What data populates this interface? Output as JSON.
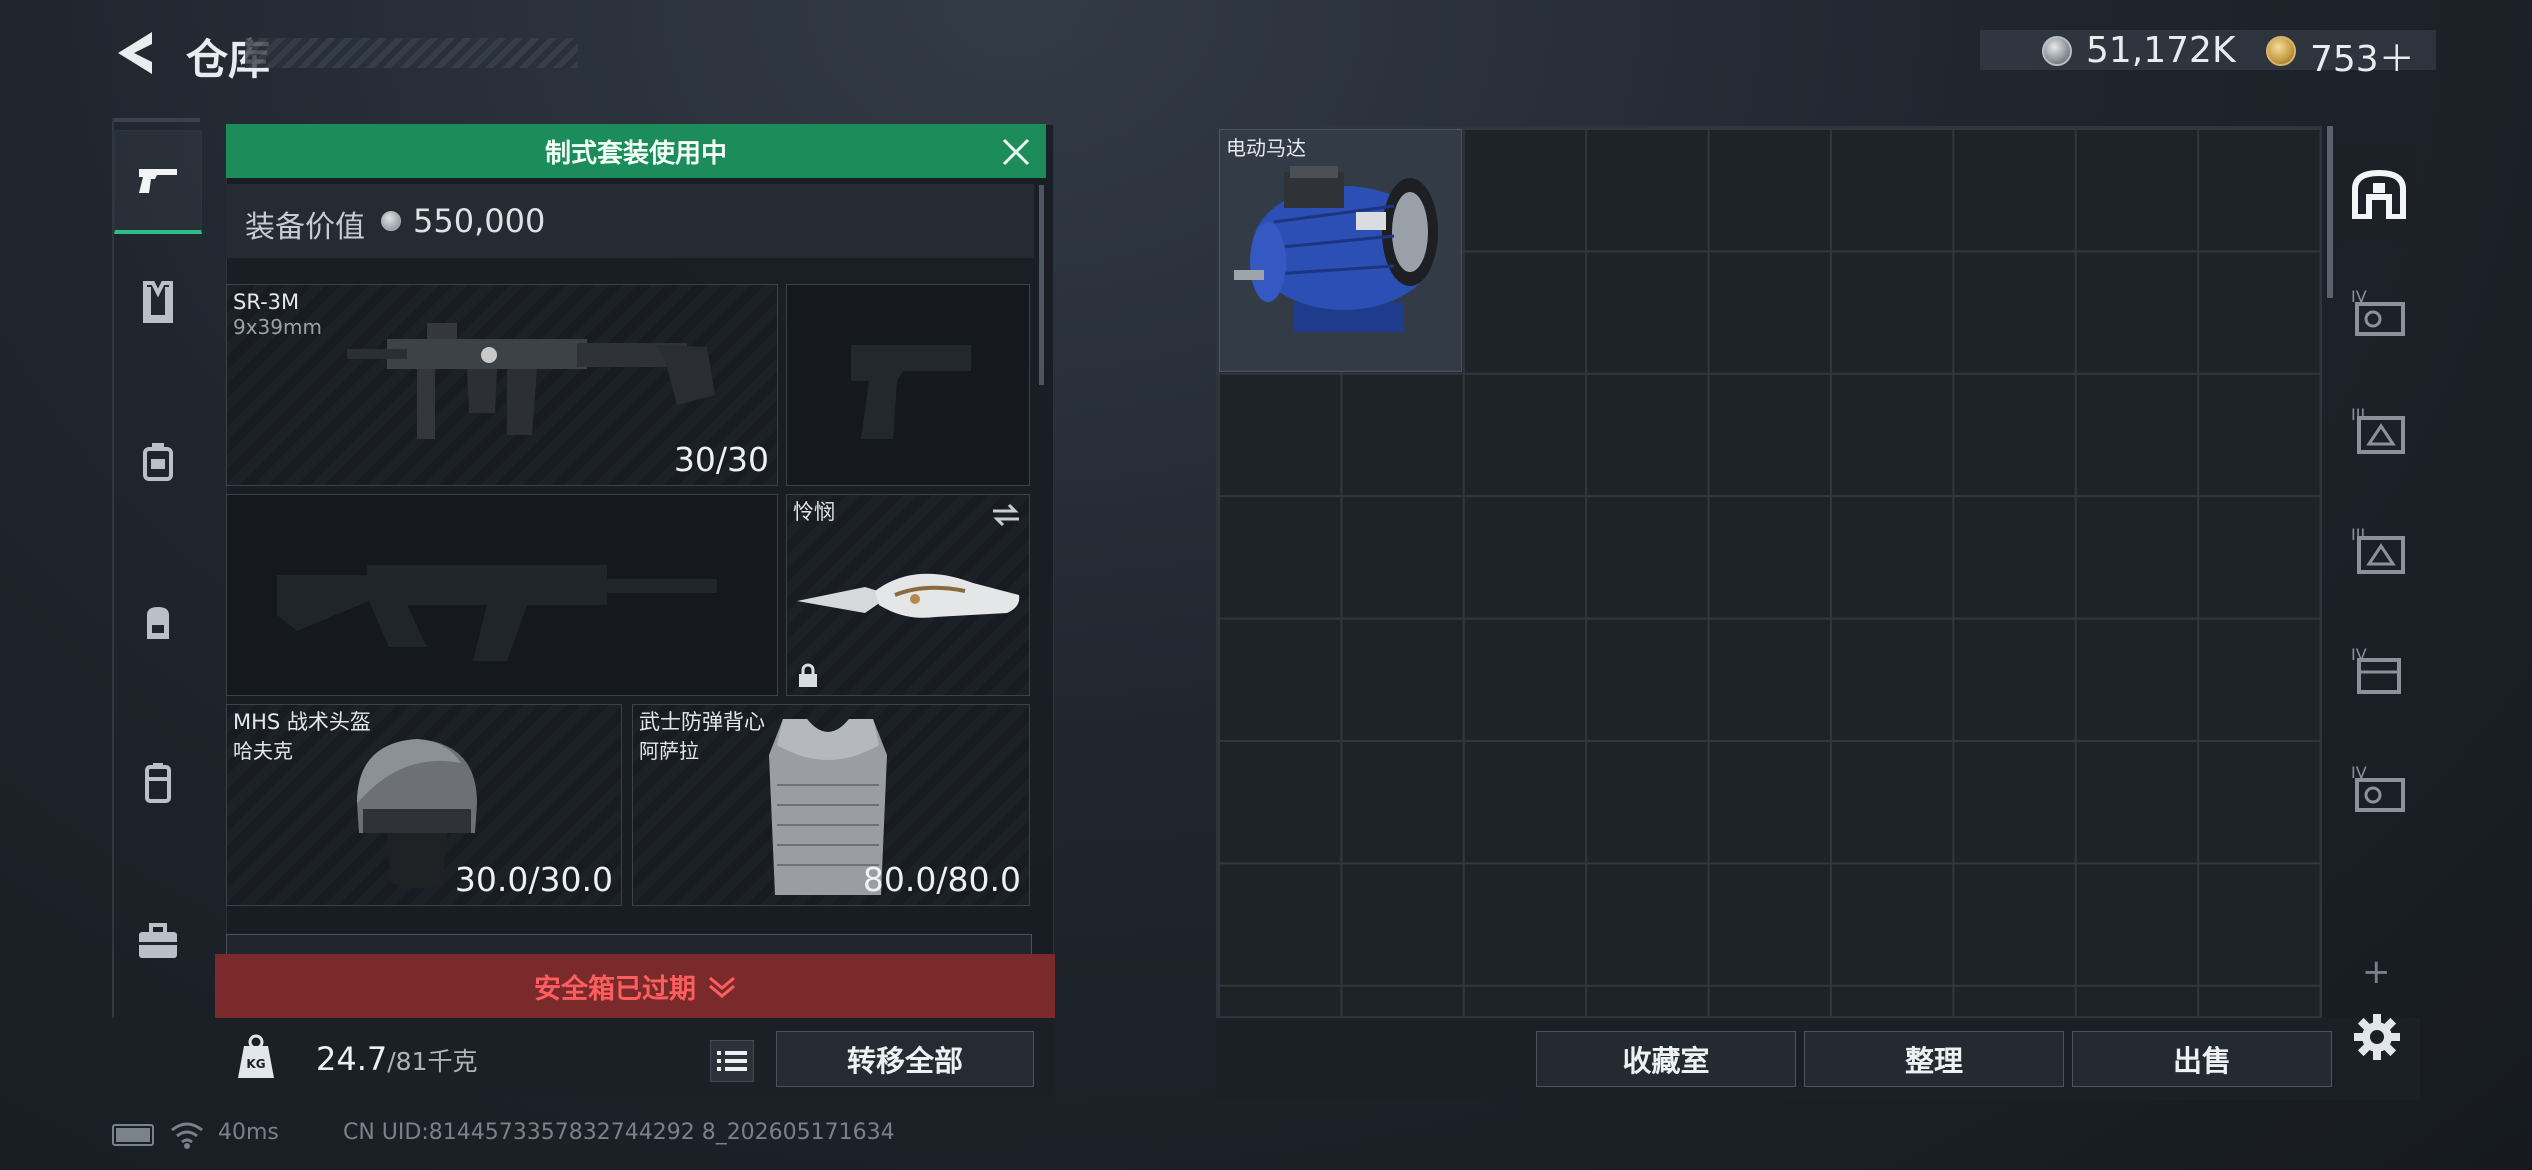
{
  "header": {
    "title": "仓库",
    "currency_silver": "51,172K",
    "currency_gold": "753＋"
  },
  "sidebar": {
    "items": [
      {
        "icon": "pistol-icon",
        "active": true
      },
      {
        "icon": "vest-icon",
        "active": false
      },
      {
        "icon": "rig-icon",
        "active": false
      },
      {
        "icon": "backpack-icon",
        "active": false
      },
      {
        "icon": "pouch-icon",
        "active": false
      },
      {
        "icon": "briefcase-icon",
        "active": false
      }
    ]
  },
  "loadout": {
    "banner": "制式套装使用中",
    "value_label": "装备价值",
    "value_amount": "550,000",
    "primary": {
      "name": "SR-3M",
      "caliber": "9x39mm",
      "ammo": "30/30"
    },
    "melee": {
      "name": "怜悯"
    },
    "helmet": {
      "name": "MHS 战术头盔",
      "sub": "哈夫克",
      "durability": "30.0/30.0"
    },
    "armor": {
      "name": "武士防弹背心",
      "sub": "阿萨拉",
      "durability": "80.0/80.0"
    },
    "expired_notice": "安全箱已过期",
    "weight_current": "24.7",
    "weight_max": "/81千克",
    "transfer_all": "转移全部"
  },
  "storage": {
    "items": [
      {
        "name": "电动马达"
      }
    ],
    "buttons": {
      "collection": "收藏室",
      "organize": "整理",
      "sell": "出售"
    },
    "tabs": [
      {
        "icon": "home-icon",
        "active": true
      },
      {
        "icon": "container-icon",
        "level": "IV"
      },
      {
        "icon": "container-icon",
        "level": "III"
      },
      {
        "icon": "container-icon",
        "level": "III"
      },
      {
        "icon": "container-icon",
        "level": "IV"
      },
      {
        "icon": "container-icon",
        "level": "IV"
      }
    ]
  },
  "status": {
    "ping": "40ms",
    "uid": "CN UID:8144573357832744292 8_202605171634"
  }
}
